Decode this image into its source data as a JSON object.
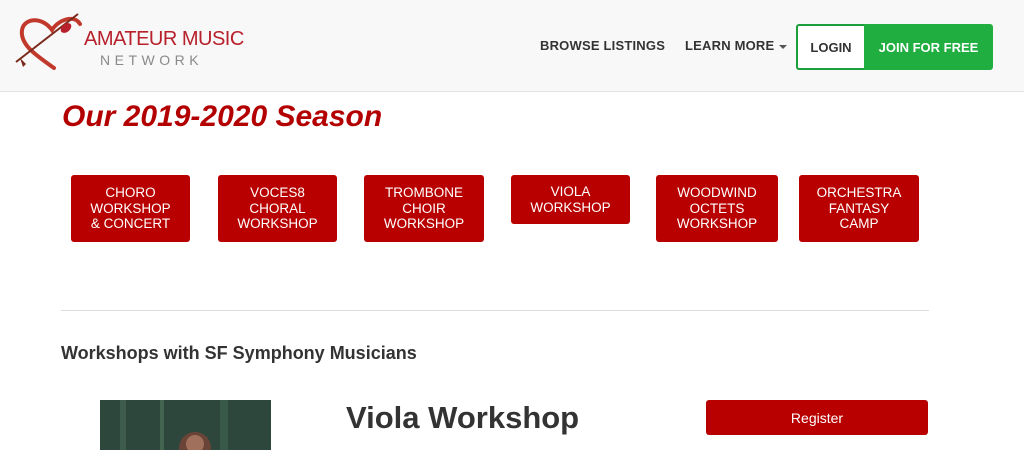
{
  "logo": {
    "line1": "AMATEUR MUSIC",
    "line2": "NETWORK",
    "colors": {
      "red": "#b8202b",
      "gray": "#8a8a8a"
    }
  },
  "nav": {
    "browse_listings": "BROWSE LISTINGS",
    "learn_more": "LEARN MORE",
    "login": "LOGIN",
    "join": "JOIN FOR FREE"
  },
  "season": {
    "title": "Our 2019-2020 Season",
    "buttons": [
      {
        "lines": [
          "CHORO",
          "WORKSHOP",
          "& CONCERT"
        ]
      },
      {
        "lines": [
          "VOCES8",
          "CHORAL",
          "WORKSHOP"
        ]
      },
      {
        "lines": [
          "TROMBONE",
          "CHOIR",
          "WORKSHOP"
        ]
      },
      {
        "lines": [
          "VIOLA",
          "WORKSHOP"
        ]
      },
      {
        "lines": [
          "WOODWIND",
          "OCTETS",
          "WORKSHOP"
        ]
      },
      {
        "lines": [
          "ORCHESTRA",
          "FANTASY",
          "CAMP"
        ]
      }
    ]
  },
  "section": {
    "title": "Workshops with SF Symphony Musicians"
  },
  "workshop": {
    "title": "Viola Workshop",
    "register": "Register"
  },
  "colors": {
    "accent_red": "#b80000",
    "green": "#1fae3f",
    "title_red": "#b30000"
  }
}
